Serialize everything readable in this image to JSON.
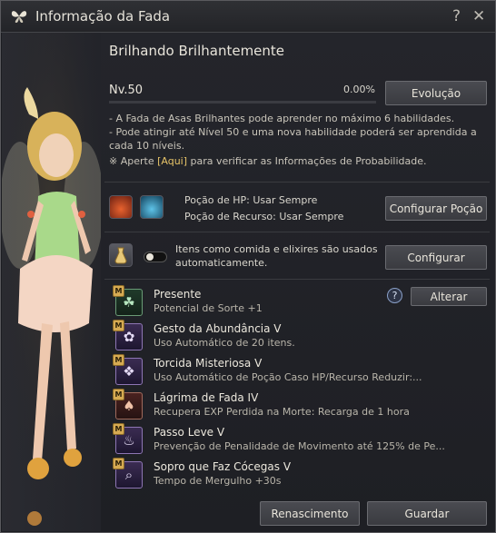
{
  "window": {
    "title": "Informação da Fada",
    "help_icon": "question-mark-icon",
    "close_icon": "close-icon",
    "title_icon": "butterfly-icon"
  },
  "fairy": {
    "name": "Brilhando Brilhantemente",
    "level": "Nv.50",
    "exp_percent": "0.00%",
    "exp_fraction": 0.0,
    "evolution_button": "Evolução"
  },
  "description": {
    "line1": "- A Fada de Asas Brilhantes pode aprender no máximo 6 habilidades.",
    "line2": "- Pode atingir até Nível 50 e uma nova habilidade poderá ser aprendida a",
    "line3": "cada 10 níveis.",
    "probability_prefix": "※ Aperte ",
    "probability_link": "[Aqui]",
    "probability_suffix": " para verificar as Informações de Probabilidade."
  },
  "potions": {
    "hp_potion": "Poção de HP: Usar Sempre",
    "resource_potion": "Poção de Recurso: Usar Sempre",
    "configure_button": "Configurar Poção"
  },
  "consumables": {
    "line1": "Itens como comida e elixires são usados",
    "line2": "automaticamente.",
    "configure_button": "Configurar",
    "toggle_on": false
  },
  "abilities_section": {
    "change_button": "Alterar",
    "help_label": "?"
  },
  "abilities": [
    {
      "badge": "M",
      "name": "Presente",
      "desc": "Potencial de Sorte +1"
    },
    {
      "badge": "M",
      "name": "Gesto da Abundância V",
      "desc": "Uso Automático de 20 itens."
    },
    {
      "badge": "M",
      "name": "Torcida Misteriosa V",
      "desc": "Uso Automático de Poção Caso HP/Recurso Reduzir:..."
    },
    {
      "badge": "M",
      "name": "Lágrima de Fada IV",
      "desc": "Recupera EXP Perdida na Morte: Recarga de 1 hora"
    },
    {
      "badge": "M",
      "name": "Passo Leve V",
      "desc": "Prevenção de Penalidade de Movimento até 125% de Pe..."
    },
    {
      "badge": "M",
      "name": "Sopro que Faz Cócegas V",
      "desc": "Tempo de Mergulho +30s"
    }
  ],
  "footer": {
    "rebirth_button": "Renascimento",
    "save_button": "Guardar"
  }
}
